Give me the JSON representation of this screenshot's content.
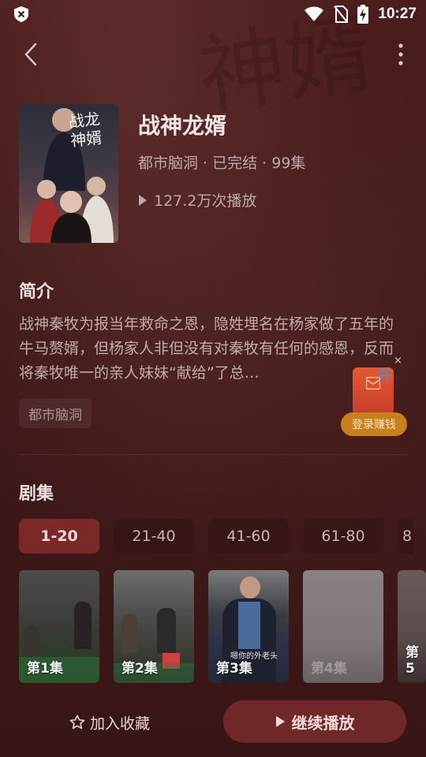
{
  "status_bar": {
    "time": "10:27",
    "icons": [
      "shield-x-icon",
      "wifi-icon",
      "no-sim-icon",
      "battery-charging-icon"
    ]
  },
  "nav": {
    "back_icon": "chevron-left-icon",
    "more_icon": "more-vertical-icon"
  },
  "drama": {
    "title": "战神龙婿",
    "meta": "都市脑洞 · 已完结 · 99集",
    "plays": "127.2万次播放",
    "poster_text": "战龙神婿"
  },
  "intro": {
    "heading": "简介",
    "text": "战神秦牧为报当年救命之恩，隐姓埋名在杨家做了五年的牛马赘婿，但杨家人非但没有对秦牧有任何的感恩，反而将秦牧唯一的亲人妹妹“献给”了总…",
    "tag": "都市脑洞"
  },
  "promo": {
    "close": "×",
    "open_text": "开",
    "pill_text": "登录赚钱",
    "packet_color": "#d9482e"
  },
  "episodes": {
    "heading": "剧集",
    "ranges": [
      "1-20",
      "21-40",
      "41-60",
      "61-80",
      "8"
    ],
    "active_range": "1-20",
    "items": [
      {
        "label": "第1集"
      },
      {
        "label": "第2集"
      },
      {
        "label": "第3集",
        "caption": "嗯你的外老头"
      },
      {
        "label": "第4集"
      },
      {
        "label": "第5"
      }
    ]
  },
  "actions": {
    "favorite_label": "加入收藏",
    "favorite_icon": "star-outline-icon",
    "play_label": "继续播放",
    "play_icon": "play-icon"
  },
  "colors": {
    "background": "#3a1515",
    "accent": "#7a2828",
    "promo_pill": "#c8801e"
  }
}
